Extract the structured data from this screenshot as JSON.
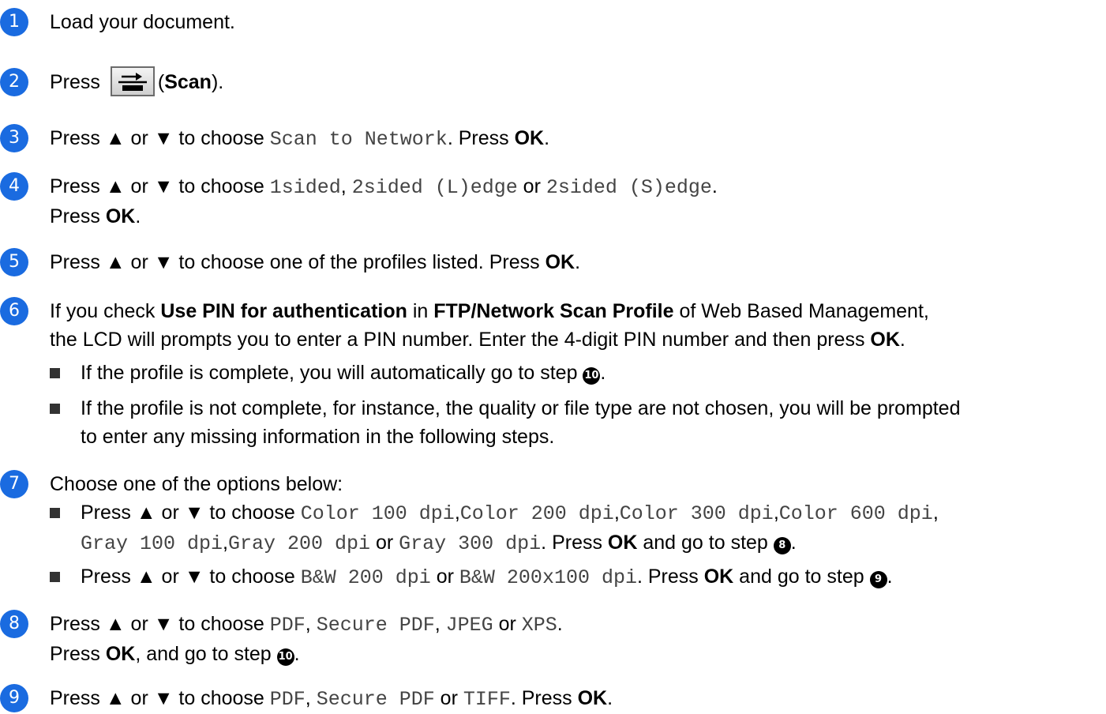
{
  "steps": [
    {
      "number": "1",
      "text": "Load your document."
    },
    {
      "number": "2",
      "text_press": "Press",
      "scan_paren_open": "(",
      "scan_label": "Scan",
      "scan_paren_close": ")."
    },
    {
      "number": "3",
      "a": "Press ▲ or ▼ to choose ",
      "mono1": "Scan to Network",
      "b": ". Press ",
      "ok": "OK",
      "c": "."
    },
    {
      "number": "4",
      "a": "Press ▲ or ▼ to choose ",
      "opt1": "1sided",
      "sep1": ", ",
      "opt2": "2sided (L)edge",
      "sep2": " or ",
      "opt3": "2sided (S)edge",
      "end": ".",
      "line2_a": "Press ",
      "ok": "OK",
      "line2_b": "."
    },
    {
      "number": "5",
      "a": "Press ▲ or ▼ to choose one of the profiles listed. Press ",
      "ok": "OK",
      "b": "."
    },
    {
      "number": "6",
      "a": "If you check ",
      "bold1": "Use PIN for authentication",
      "b": " in ",
      "bold2": "FTP/Network Scan Profile",
      "c": " of Web Based Management,",
      "line2": "the LCD will prompts you to enter a PIN number. Enter the 4-digit PIN number and then press ",
      "ok": "OK",
      "line2_end": ".",
      "bullet1_a": "If the profile is complete, you will automatically go to step ",
      "bullet1_ref": "10",
      "bullet1_end": ".",
      "bullet2_line1": "If the profile is not complete, for instance, the quality or file type are not chosen, you will be prompted",
      "bullet2_line2": "to enter any missing information in the following steps."
    },
    {
      "number": "7",
      "text": "Choose one of the options below:",
      "bullet1_a": "Press ▲ or ▼ to choose ",
      "c100": "Color 100 dpi",
      "comma": ",",
      "c200": "Color 200 dpi",
      "c300": "Color 300 dpi",
      "c600": "Color 600 dpi",
      "g100": "Gray 100 dpi",
      "g200": "Gray 200 dpi",
      "or": " or ",
      "g300": "Gray 300 dpi",
      "press": ". Press ",
      "ok": "OK",
      "goto": " and go to step ",
      "ref8": "8",
      "dot": ".",
      "bullet2_a": "Press ▲ or ▼ to choose ",
      "bw200": "B&W 200 dpi",
      "bw200x100": "B&W 200x100 dpi",
      "ref9": "9"
    },
    {
      "number": "8",
      "a": "Press ▲ or ▼ to choose ",
      "pdf": "PDF",
      "sep": ", ",
      "spdf": "Secure PDF",
      "jpeg": "JPEG",
      "or": " or ",
      "xps": "XPS",
      "end": ".",
      "line2_a": "Press ",
      "ok": "OK",
      "line2_b": ", and go to step ",
      "ref10": "10",
      "line2_end": "."
    },
    {
      "number": "9",
      "a": "Press ▲ or ▼ to choose ",
      "pdf": "PDF",
      "sep": ", ",
      "spdf": "Secure PDF",
      "or": " or ",
      "tiff": "TIFF",
      "b": ". Press ",
      "ok": "OK",
      "end": "."
    }
  ],
  "colors": {
    "step_circle": "#1a6be0",
    "mono_text": "#444444"
  },
  "icons": {
    "scan_button": "scan-key-icon"
  }
}
